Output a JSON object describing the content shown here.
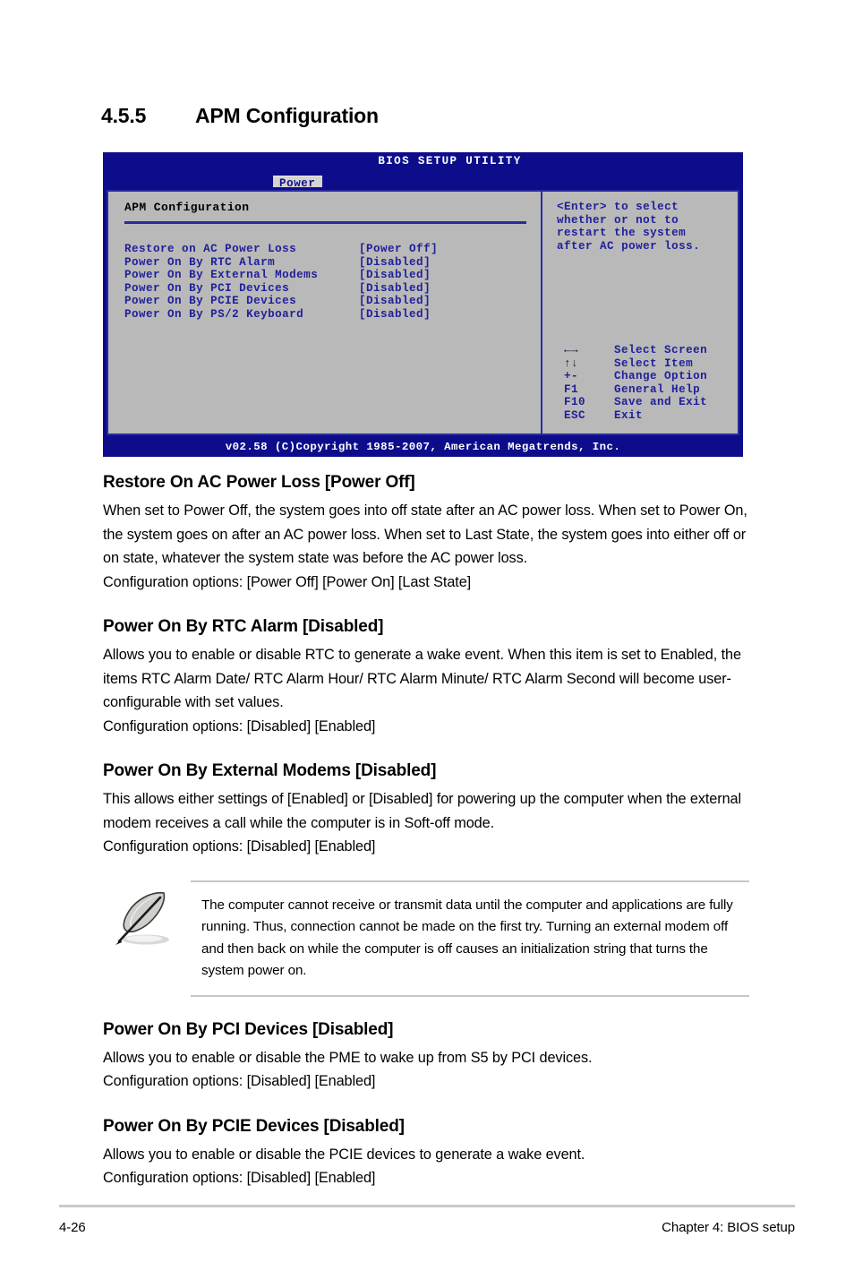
{
  "section": {
    "number": "4.5.5",
    "title": "APM Configuration"
  },
  "bios": {
    "utility_title": "BIOS SETUP UTILITY",
    "active_tab": "Power",
    "panel_title": "APM Configuration",
    "items": [
      {
        "label": "Restore on AC Power Loss",
        "value": "[Power Off]"
      },
      {
        "label": "Power On By RTC Alarm",
        "value": "[Disabled]"
      },
      {
        "label": "Power On By External Modems",
        "value": "[Disabled]"
      },
      {
        "label": "Power On By PCI Devices",
        "value": "[Disabled]"
      },
      {
        "label": "Power On By PCIE Devices",
        "value": "[Disabled]"
      },
      {
        "label": "Power On By PS/2 Keyboard",
        "value": "[Disabled]"
      }
    ],
    "help_text": "<Enter> to select\nwhether or not to\nrestart the system\nafter AC power loss.",
    "keys": [
      {
        "key": "←→",
        "desc": "Select Screen"
      },
      {
        "key": "↑↓",
        "desc": "Select Item"
      },
      {
        "key": "+-",
        "desc": "Change Option"
      },
      {
        "key": "F1",
        "desc": "General Help"
      },
      {
        "key": "F10",
        "desc": "Save and Exit"
      },
      {
        "key": "ESC",
        "desc": "Exit"
      }
    ],
    "copyright": "v02.58 (C)Copyright 1985-2007, American Megatrends, Inc."
  },
  "entries": [
    {
      "heading": "Restore On AC Power Loss [Power Off]",
      "body": "When set to Power Off, the system goes into off state after an AC power loss. When set to Power On, the system goes on after an AC power loss. When set to Last State, the system goes into either off or on state, whatever the system state was before the AC power loss.\nConfiguration options: [Power Off] [Power On] [Last State]"
    },
    {
      "heading": "Power On By RTC Alarm [Disabled]",
      "body": "Allows you to enable or disable RTC to generate a wake event. When this item is set to Enabled, the items RTC Alarm Date/ RTC Alarm Hour/ RTC Alarm Minute/ RTC Alarm Second will become user-configurable with set values.\nConfiguration options: [Disabled] [Enabled]"
    },
    {
      "heading": "Power On By External Modems [Disabled]",
      "body": "This allows either settings of [Enabled] or [Disabled] for powering up the computer when the external modem receives a call while the computer is in Soft-off mode.\nConfiguration options: [Disabled] [Enabled]"
    },
    {
      "heading": "Power On By PCI Devices [Disabled]",
      "body": "Allows you to enable or disable the PME to wake up from S5 by PCI devices.\nConfiguration options: [Disabled] [Enabled]"
    },
    {
      "heading": "Power On By PCIE Devices [Disabled]",
      "body": "Allows you to enable or disable the PCIE devices to generate a wake event.\nConfiguration options: [Disabled] [Enabled]"
    }
  ],
  "note": {
    "icon": "quill-pen-icon",
    "text": "The computer cannot receive or transmit data until the computer and applications are fully running. Thus, connection cannot be made on the first try. Turning an external modem off and then back on while the computer is off causes an initialization string that turns the system power on."
  },
  "footer": {
    "page_number": "4-26",
    "chapter": "Chapter 4: BIOS setup"
  },
  "colors": {
    "bios_header_blue": "#0d0d8c",
    "bios_text_blue": "#20209a",
    "bios_panel_gray": "#b9b9b9",
    "rule_gray": "#c9c9c9"
  }
}
